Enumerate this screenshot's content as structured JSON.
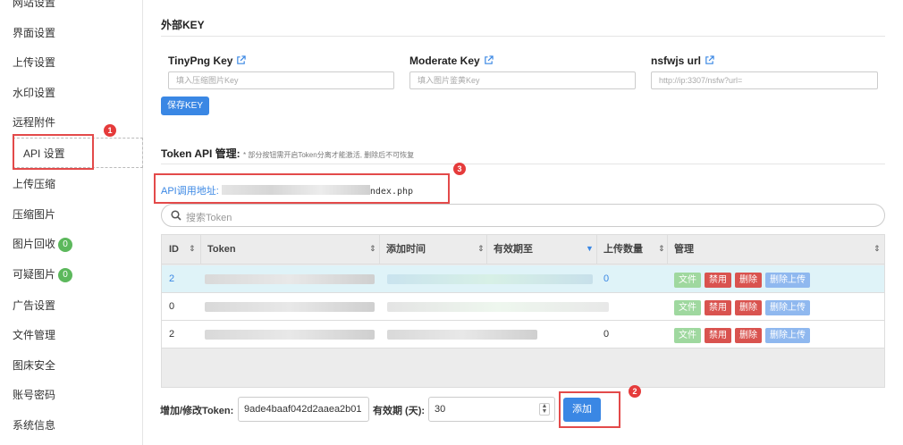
{
  "sidebar": {
    "items": [
      {
        "label": "网站设置"
      },
      {
        "label": "界面设置"
      },
      {
        "label": "上传设置"
      },
      {
        "label": "水印设置"
      },
      {
        "label": "远程附件"
      },
      {
        "label": "API 设置"
      },
      {
        "label": "上传压缩"
      },
      {
        "label": "压缩图片"
      },
      {
        "label": "图片回收",
        "badge": "0"
      },
      {
        "label": "可疑图片",
        "badge": "0"
      },
      {
        "label": "广告设置"
      },
      {
        "label": "文件管理"
      },
      {
        "label": "图床安全"
      },
      {
        "label": "账号密码"
      },
      {
        "label": "系统信息"
      }
    ]
  },
  "external_key": {
    "title": "外部KEY",
    "tinypng": {
      "label": "TinyPng Key",
      "placeholder": "填入压缩图片Key"
    },
    "moderate": {
      "label": "Moderate Key",
      "placeholder": "填入图片鉴黄Key"
    },
    "nsfwjs": {
      "label": "nsfwjs url",
      "placeholder": "http://ip:3307/nsfw?url="
    },
    "save_label": "保存KEY"
  },
  "token_api": {
    "title": "Token API 管理:",
    "note": "* 部分按钮需开启Token分离才能激活, 删除后不可恢复",
    "api_url_label": "API调用地址:",
    "api_url_tail": "ndex.php"
  },
  "search": {
    "placeholder": "搜索Token"
  },
  "table": {
    "headers": {
      "id": "ID",
      "token": "Token",
      "added": "添加时间",
      "expires": "有效期至",
      "uploads": "上传数量",
      "manage": "管理"
    },
    "rows": [
      {
        "id": "2",
        "uploads": "0"
      },
      {
        "id": "0",
        "uploads": ""
      },
      {
        "id": "2",
        "uploads": "0"
      }
    ],
    "actions": {
      "file": "文件",
      "disable": "禁用",
      "delete": "删除",
      "delete_uploads": "删除上传"
    }
  },
  "form": {
    "token_label": "增加/修改Token:",
    "token_value": "9ade4baaf042d2aaea2b01",
    "expiry_label": "有效期 (天):",
    "expiry_value": "30",
    "add_label": "添加"
  },
  "annotations": {
    "one": "1",
    "two": "2",
    "three": "3"
  },
  "colors": {
    "accent": "#3a87e4",
    "danger": "#d9534f",
    "success": "#5cb85c",
    "annotation": "#e53b3b"
  }
}
